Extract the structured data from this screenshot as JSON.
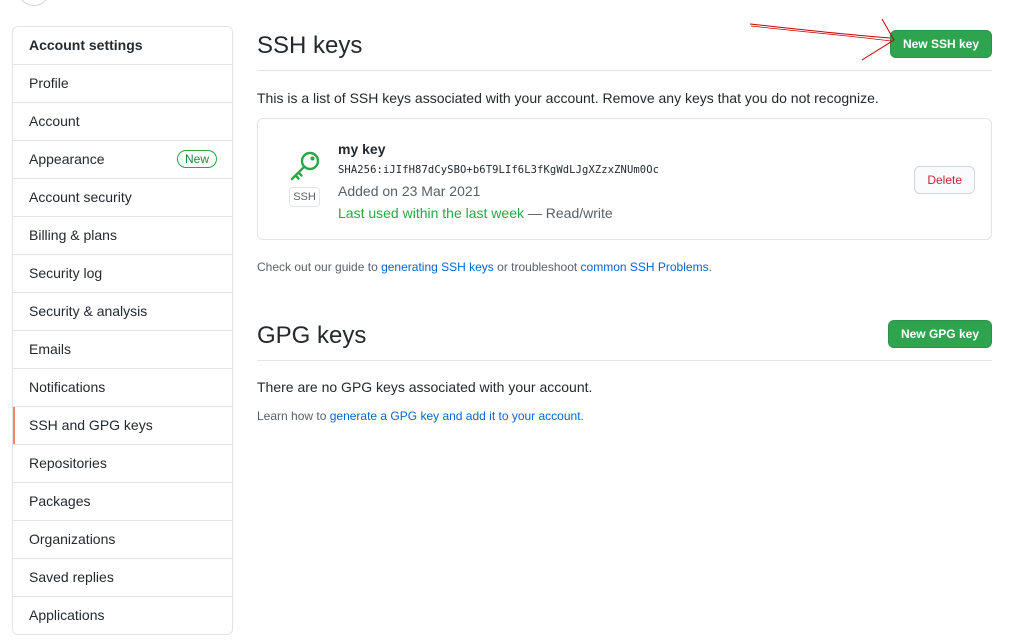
{
  "sidebar": {
    "header": "Account settings",
    "items": [
      {
        "label": "Profile"
      },
      {
        "label": "Account"
      },
      {
        "label": "Appearance",
        "badge": "New"
      },
      {
        "label": "Account security"
      },
      {
        "label": "Billing & plans"
      },
      {
        "label": "Security log"
      },
      {
        "label": "Security & analysis"
      },
      {
        "label": "Emails"
      },
      {
        "label": "Notifications"
      },
      {
        "label": "SSH and GPG keys",
        "selected": true
      },
      {
        "label": "Repositories"
      },
      {
        "label": "Packages"
      },
      {
        "label": "Organizations"
      },
      {
        "label": "Saved replies"
      },
      {
        "label": "Applications"
      }
    ]
  },
  "ssh": {
    "title": "SSH keys",
    "new_button": "New SSH key",
    "description": "This is a list of SSH keys associated with your account. Remove any keys that you do not recognize.",
    "key": {
      "icon": "key-icon",
      "type_label": "SSH",
      "title": "my key",
      "fingerprint": "SHA256:iJIfH87dCySBO+b6T9LIf6L3fKgWdLJgXZzxZNUm0Oc",
      "added": "Added on 23 Mar 2021",
      "last_used": "Last used within the last week",
      "separator": " — ",
      "access": "Read/write",
      "delete_button": "Delete"
    },
    "help": {
      "prefix": "Check out our guide to ",
      "link1": "generating SSH keys",
      "middle": " or troubleshoot ",
      "link2": "common SSH Problems",
      "suffix": "."
    }
  },
  "gpg": {
    "title": "GPG keys",
    "new_button": "New GPG key",
    "empty": "There are no GPG keys associated with your account.",
    "help": {
      "prefix": "Learn how to ",
      "link": "generate a GPG key and add it to your account",
      "suffix": "."
    }
  },
  "colors": {
    "green_button": "#2ea44f",
    "link": "#0366d6",
    "danger": "#cb2431",
    "selected_indicator": "#f9826c",
    "annotation_arrow": "#cc0000"
  }
}
